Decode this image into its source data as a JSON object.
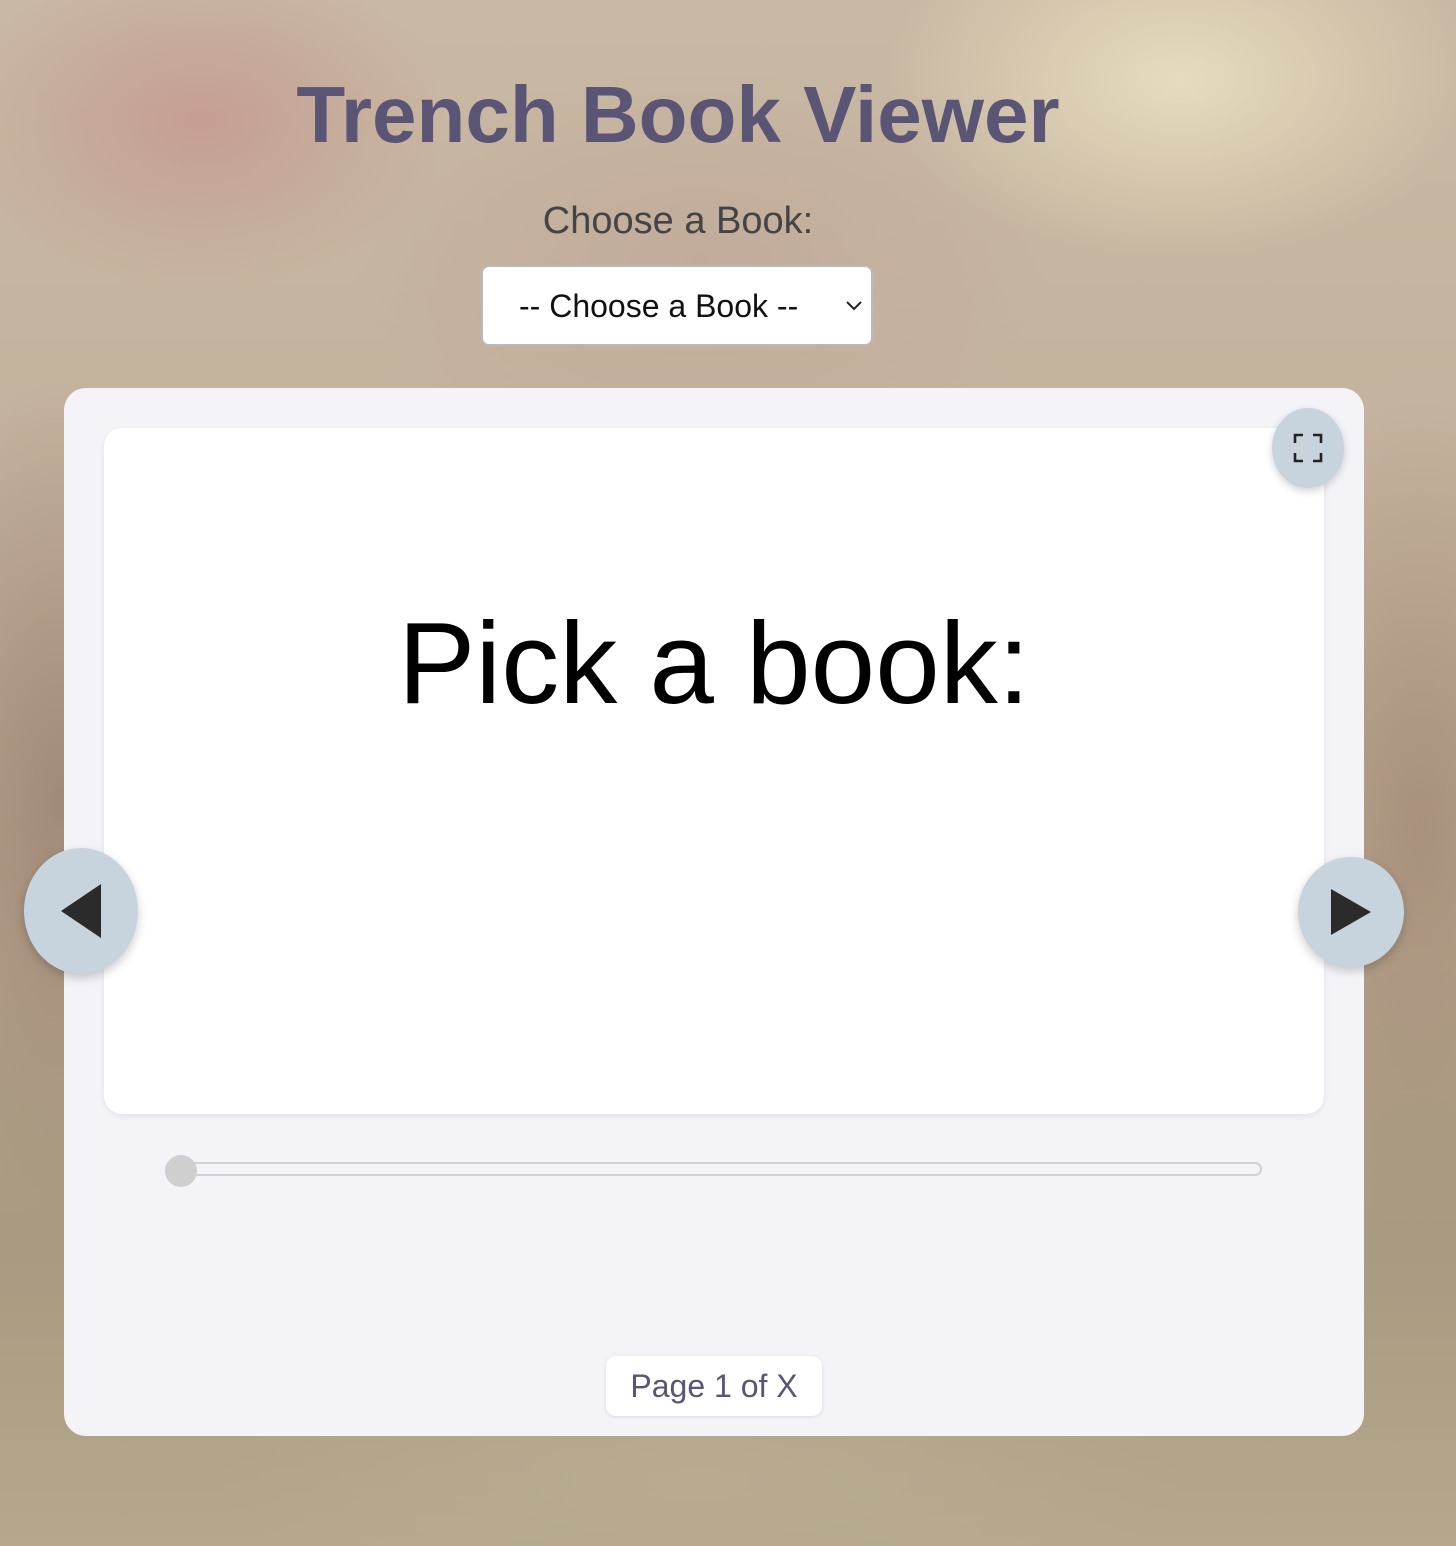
{
  "header": {
    "title": "Trench Book Viewer"
  },
  "book_picker": {
    "label": "Choose a Book:",
    "selected_value": "-- Choose a Book --"
  },
  "viewer": {
    "page_text": "Pick a book:",
    "page_indicator": "Page 1 of X",
    "slider_position": 0
  },
  "icons": {
    "fullscreen": "fullscreen-icon",
    "prev": "triangle-left-icon",
    "next": "triangle-right-icon",
    "select_chevron": "chevron-down-icon"
  },
  "colors": {
    "title": "#5a5575",
    "nav_button": "#c7d4de",
    "card_background": "#f4f3f8"
  }
}
